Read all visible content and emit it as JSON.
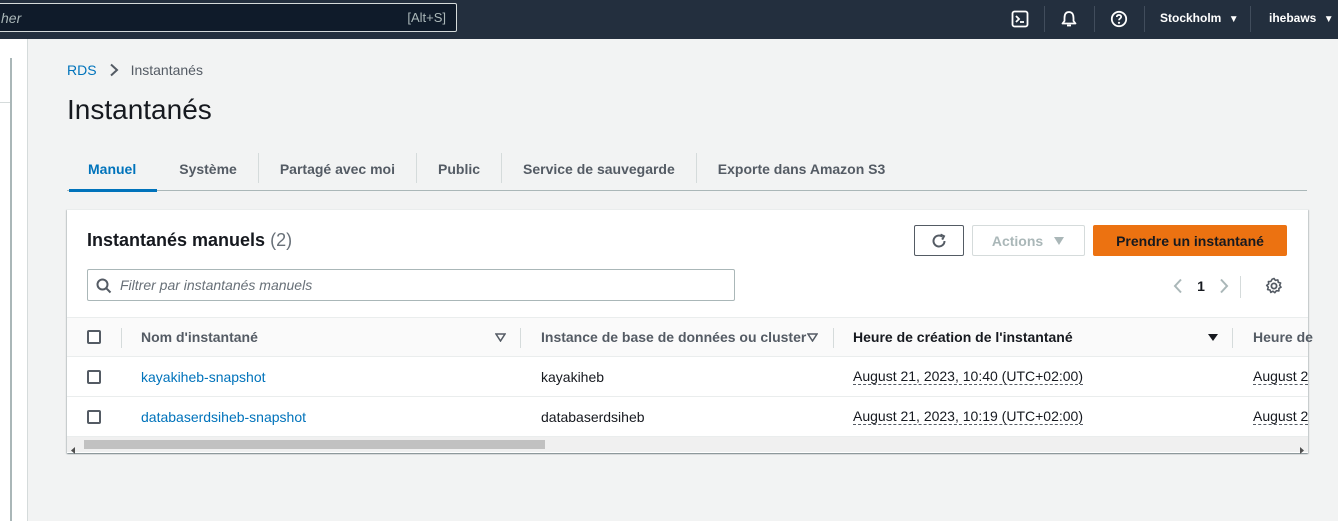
{
  "topbar": {
    "search_placeholder": "her",
    "search_shortcut": "[Alt+S]",
    "icons": [
      "cloudshell-icon",
      "bell-icon",
      "help-icon"
    ],
    "region": "Stockholm",
    "user": "ihebaws"
  },
  "breadcrumb": {
    "root": "RDS",
    "current": "Instantanés"
  },
  "page_title": "Instantanés",
  "tabs": [
    {
      "label": "Manuel",
      "active": true
    },
    {
      "label": "Système"
    },
    {
      "label": "Partagé avec moi"
    },
    {
      "label": "Public"
    },
    {
      "label": "Service de sauvegarde"
    },
    {
      "label": "Exporte dans Amazon S3"
    }
  ],
  "panel": {
    "title": "Instantanés manuels",
    "count": "(2)",
    "actions_label": "Actions",
    "primary_label": "Prendre un instantané",
    "filter_placeholder": "Filtrer par instantanés manuels",
    "page": "1"
  },
  "table": {
    "headers": [
      "Nom d'instantané",
      "Instance de base de données ou cluster",
      "Heure de création de l'instantané",
      "Heure de"
    ],
    "rows": [
      {
        "name": "kayakiheb-snapshot",
        "instance": "kayakiheb",
        "created": "August 21, 2023, 10:40 (UTC+02:00)",
        "next": "August 2"
      },
      {
        "name": "databaserdsiheb-snapshot",
        "instance": "databaserdsiheb",
        "created": "August 21, 2023, 10:19 (UTC+02:00)",
        "next": "August 2"
      }
    ]
  },
  "colors": {
    "topbar": "#232f3e",
    "link": "#0073bb",
    "primary": "#ec7211",
    "background": "#f2f3f3"
  }
}
